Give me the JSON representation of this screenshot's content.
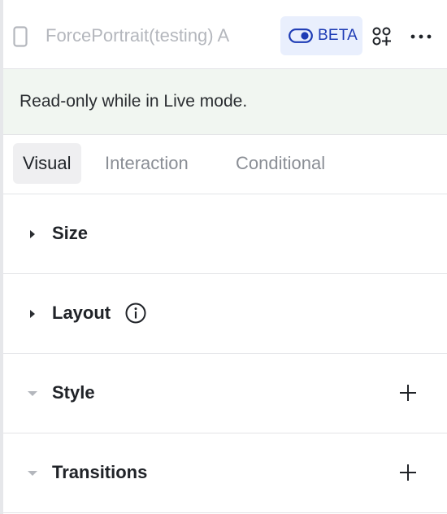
{
  "header": {
    "device_icon": "phone-outline-icon",
    "title": "ForcePortrait(testing) A",
    "beta_label": "BETA",
    "toggle_icon": "toggle-icon",
    "components_icon": "components-add-icon",
    "more_icon": "more-horizontal-icon",
    "accent_color": "#1d3bb5"
  },
  "notice": {
    "text": "Read-only while in Live mode."
  },
  "tabs": [
    {
      "label": "Visual",
      "active": true
    },
    {
      "label": "Interaction",
      "active": false
    },
    {
      "label": "Conditional",
      "active": false
    }
  ],
  "sections": [
    {
      "label": "Size",
      "state": "collapsed",
      "arrow_icon": "caret-right-icon"
    },
    {
      "label": "Layout",
      "state": "collapsed",
      "arrow_icon": "caret-right-icon",
      "extra_icon": "info-icon"
    },
    {
      "label": "Style",
      "state": "expanded-disabled",
      "arrow_icon": "caret-down-icon",
      "action_icon": "plus-icon"
    },
    {
      "label": "Transitions",
      "state": "expanded-disabled",
      "arrow_icon": "caret-down-icon",
      "action_icon": "plus-icon"
    }
  ]
}
